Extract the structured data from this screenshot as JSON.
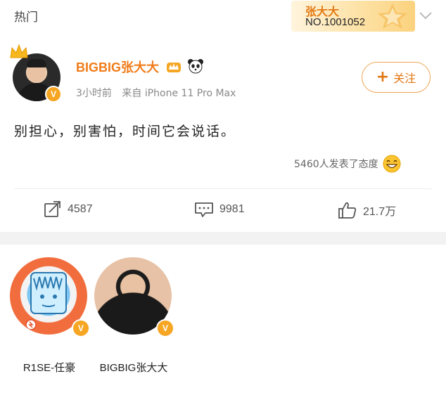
{
  "topbar": {
    "tab_label": "热门",
    "fan_badge": {
      "name": "张大大",
      "number": "NO.1001052"
    }
  },
  "post": {
    "username": "BIGBIG张大大",
    "time": "3小时前",
    "source": "来自 iPhone 11 Pro Max",
    "follow_label": "关注",
    "content": "别担心，别害怕，时间它会说话。",
    "attitude": "5460人发表了态度",
    "actions": {
      "repost_count": "4587",
      "comment_count": "9981",
      "like_count": "21.7万"
    }
  },
  "likers": [
    {
      "name": "R1SE-任豪"
    },
    {
      "name": "BIGBIG张大大"
    }
  ],
  "colors": {
    "accent": "#f07c1a",
    "verified": "#f6a623",
    "separator": "#f2f2f2"
  }
}
